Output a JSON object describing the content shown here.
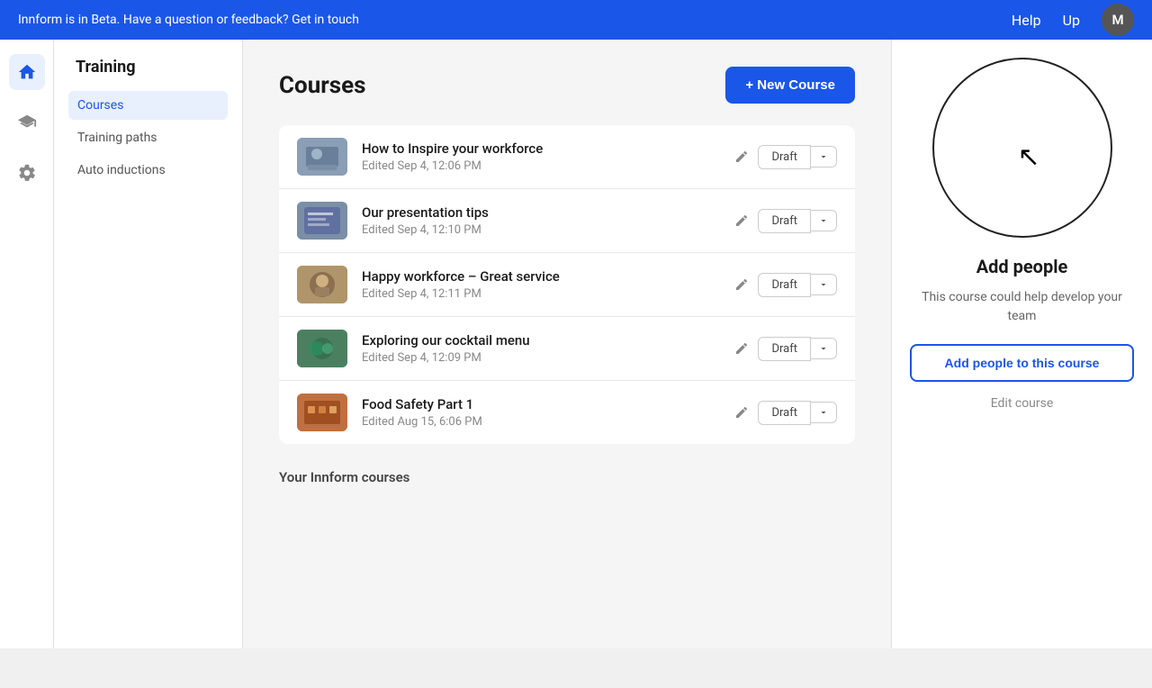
{
  "banner": {
    "text": "Innform is in Beta. Have a question or feedback? Get in touch",
    "help_label": "Help",
    "upgrade_label": "Up",
    "avatar_initial": "M"
  },
  "icon_sidebar": {
    "home_icon": "⌂",
    "training_icon": "🎓",
    "settings_icon": "⚙"
  },
  "nav": {
    "section_title": "Training",
    "items": [
      {
        "label": "Courses",
        "active": true
      },
      {
        "label": "Training paths",
        "active": false
      },
      {
        "label": "Auto inductions",
        "active": false
      }
    ]
  },
  "main": {
    "page_title": "Courses",
    "new_course_label": "+ New Course",
    "courses": [
      {
        "name": "How to Inspire your workforce",
        "edited": "Edited Sep 4, 12:06 PM",
        "status": "Draft",
        "thumb_class": "thumb-1"
      },
      {
        "name": "Our presentation tips",
        "edited": "Edited Sep 4, 12:10 PM",
        "status": "Draft",
        "thumb_class": "thumb-2"
      },
      {
        "name": "Happy workforce – Great service",
        "edited": "Edited Sep 4, 12:11 PM",
        "status": "Draft",
        "thumb_class": "thumb-3"
      },
      {
        "name": "Exploring our cocktail menu",
        "edited": "Edited Sep 4, 12:09 PM",
        "status": "Draft",
        "thumb_class": "thumb-4"
      },
      {
        "name": "Food Safety Part 1",
        "edited": "Edited Aug 15, 6:06 PM",
        "status": "Draft",
        "thumb_class": "thumb-5"
      }
    ],
    "your_innform_label": "Your Innform courses"
  },
  "right_panel": {
    "add_people_title": "Add people",
    "add_people_desc": "This course could help develop your team",
    "add_people_btn_label": "Add people to this course",
    "edit_course_label": "Edit course"
  }
}
